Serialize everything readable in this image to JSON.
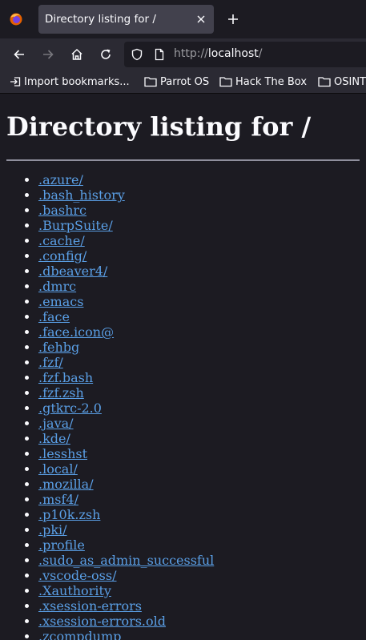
{
  "browser": {
    "tab_title": "Directory listing for /",
    "url_scheme": "http://",
    "url_host": "localhost",
    "url_path": "/",
    "bookmarks": [
      "Import bookmarks...",
      "Parrot OS",
      "Hack The Box",
      "OSINT"
    ]
  },
  "page": {
    "heading": "Directory listing for /",
    "entries": [
      ".azure/",
      ".bash_history",
      ".bashrc",
      ".BurpSuite/",
      ".cache/",
      ".config/",
      ".dbeaver4/",
      ".dmrc",
      ".emacs",
      ".face",
      ".face.icon@",
      ".fehbg",
      ".fzf/",
      ".fzf.bash",
      ".fzf.zsh",
      ".gtkrc-2.0",
      ".java/",
      ".kde/",
      ".lesshst",
      ".local/",
      ".mozilla/",
      ".msf4/",
      ".p10k.zsh",
      ".pki/",
      ".profile",
      ".sudo_as_admin_successful",
      ".vscode-oss/",
      ".Xauthority",
      ".xsession-errors",
      ".xsession-errors.old",
      ".zcompdump"
    ]
  },
  "colors": {
    "link": "#5a9fe6",
    "background": "#1c1b22",
    "toolbar": "#2b2a33",
    "tab_active": "#42414d"
  },
  "icons": {
    "app": "firefox-icon",
    "back": "arrow-left-icon",
    "forward": "arrow-right-icon",
    "home": "home-icon",
    "reload": "reload-icon",
    "shield": "shield-icon",
    "page": "page-icon",
    "import": "import-icon",
    "folder": "folder-icon"
  }
}
